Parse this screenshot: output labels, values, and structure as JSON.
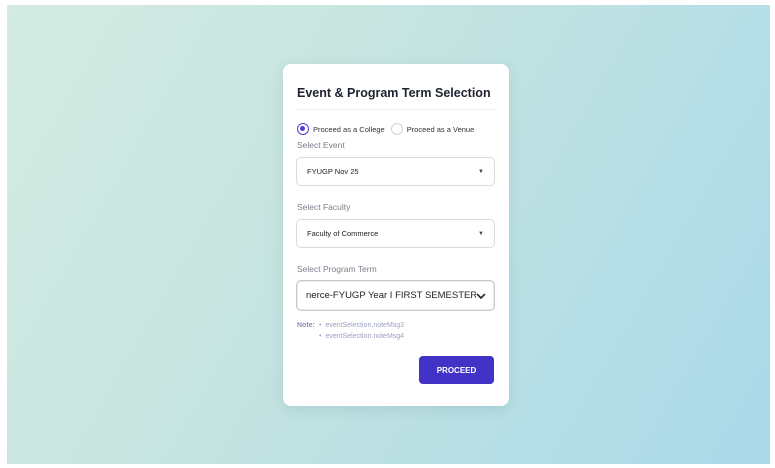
{
  "card": {
    "title": "Event & Program Term Selection"
  },
  "mode": {
    "options": [
      "Proceed as a College",
      "Proceed as a Venue"
    ],
    "selected": "Proceed as a College"
  },
  "event": {
    "label": "Select Event",
    "value": "FYUGP Nov 25"
  },
  "faculty": {
    "label": "Select Faculty",
    "value": "Faculty of Commerce"
  },
  "term": {
    "label": "Select Program Term",
    "value": "nerce-FYUGP Year I FIRST SEMESTER"
  },
  "note": {
    "heading": "Note:",
    "items": [
      "eventSelection.noteMsg3",
      "eventSelection.noteMsg4"
    ]
  },
  "actions": {
    "proceed_label": "PROCEED"
  },
  "colors": {
    "accent": "#4232c5",
    "background_start": "#d3ebe2",
    "background_end": "#a9d8e8"
  }
}
